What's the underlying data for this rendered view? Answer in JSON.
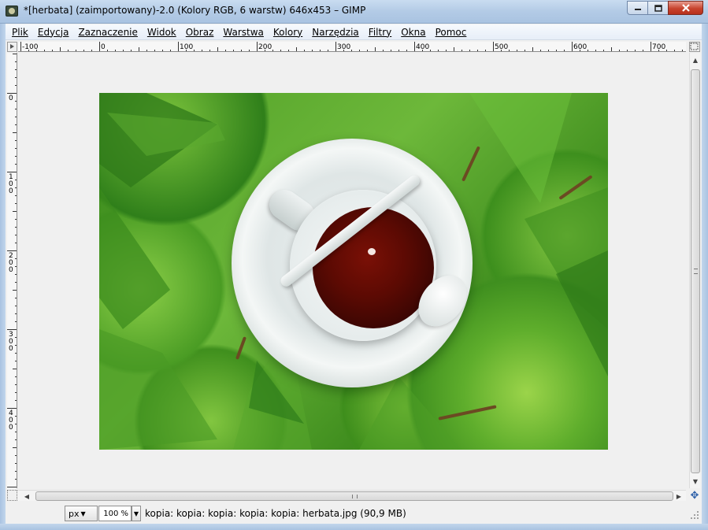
{
  "window": {
    "title": "*[herbata] (zaimportowany)-2.0 (Kolory RGB, 6 warstw) 646x453 – GIMP",
    "minimize_icon": "minimize-icon",
    "maximize_icon": "maximize-icon",
    "close_icon": "close-icon"
  },
  "menu": [
    {
      "label": "Plik"
    },
    {
      "label": "Edycja"
    },
    {
      "label": "Zaznaczenie"
    },
    {
      "label": "Widok"
    },
    {
      "label": "Obraz"
    },
    {
      "label": "Warstwa"
    },
    {
      "label": "Kolory"
    },
    {
      "label": "Narzędzia"
    },
    {
      "label": "Filtry"
    },
    {
      "label": "Okna"
    },
    {
      "label": "Pomoc"
    }
  ],
  "rulers": {
    "horizontal_labels": [
      "-100",
      "0",
      "100",
      "200",
      "300",
      "400",
      "500",
      "600",
      "700"
    ],
    "vertical_labels": [
      "0",
      "100",
      "200",
      "300",
      "400"
    ]
  },
  "status": {
    "unit": "px",
    "zoom": "100 %",
    "message": "kopia: kopia: kopia: kopia: kopia: herbata.jpg (90,9 MB)"
  },
  "colors": {
    "title_bar": "#b3cbe6",
    "close_button": "#c7432d",
    "canvas_bg": "#f0f0f0"
  }
}
